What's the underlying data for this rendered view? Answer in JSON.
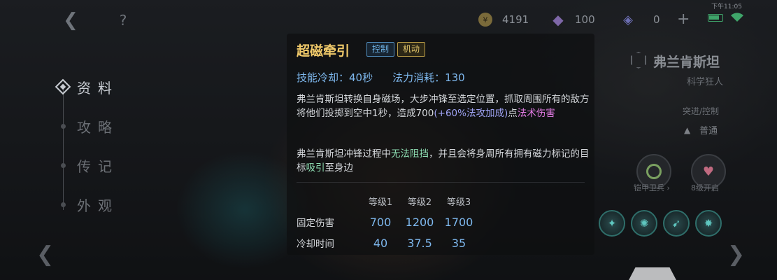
{
  "topbar": {
    "back_icon": "chevron-left-icon",
    "help_label": "?",
    "gold": "4191",
    "gems": "100",
    "tickets": "0",
    "plus_label": "+",
    "time": "下午11:05"
  },
  "leftnav": {
    "items": [
      {
        "label": "资料",
        "active": true
      },
      {
        "label": "攻略",
        "active": false
      },
      {
        "label": "传记",
        "active": false
      },
      {
        "label": "外观",
        "active": false
      }
    ]
  },
  "skill": {
    "name": "超磁牵引",
    "tags": [
      "控制",
      "机动"
    ],
    "cooldown": "技能冷却：40秒",
    "mana": "法力消耗：130",
    "desc1_a": "弗兰肯斯坦转换自身磁场，大步冲锋至选定位置，抓取周围所有的敌方将他们投掷到空中1秒，造成700",
    "desc1_b": "(+60%法攻加成)",
    "desc1_c": "点",
    "desc1_d": "法术伤害",
    "desc2_a": "弗兰肯斯坦冲锋过程中",
    "desc2_b": "无法阻挡",
    "desc2_c": "，并且会将身周所有拥有磁力标记的目标",
    "desc2_d": "吸引",
    "desc2_e": "至身边",
    "levels": {
      "headers": [
        "等级1",
        "等级2",
        "等级3"
      ],
      "rows": [
        {
          "label": "固定伤害",
          "values": [
            "700",
            "1200",
            "1700"
          ]
        },
        {
          "label": "冷却时间",
          "values": [
            "40",
            "37.5",
            "35"
          ]
        }
      ]
    }
  },
  "hero": {
    "name": "弗兰肯斯坦",
    "title": "科学狂人",
    "role": "突进/控制",
    "difficulty": "普通",
    "medal1_label": "铠甲卫兵 ›",
    "medal2_label": "8级开启"
  },
  "colors": {
    "skill_name": "#f0c96a",
    "stat_blue": "#7eb8ee",
    "magic_pink": "#e67de8",
    "highlight_green": "#8fe0b4"
  }
}
